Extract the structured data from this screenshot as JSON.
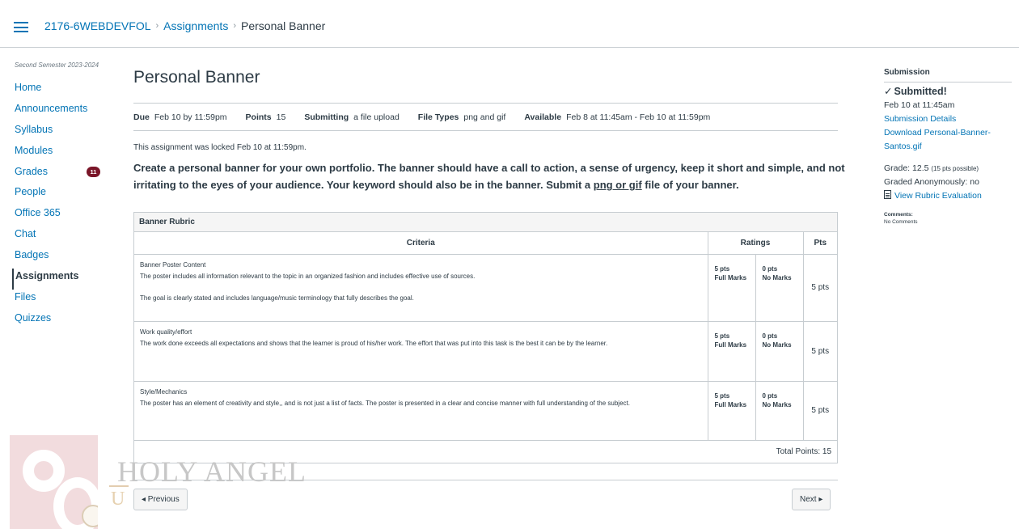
{
  "breadcrumb": {
    "course": "2176-6WEBDEVFOL",
    "section": "Assignments",
    "current": "Personal Banner"
  },
  "sidebar": {
    "term": "Second Semester 2023-2024",
    "items": [
      {
        "label": "Home"
      },
      {
        "label": "Announcements"
      },
      {
        "label": "Syllabus"
      },
      {
        "label": "Modules"
      },
      {
        "label": "Grades",
        "badge": "11"
      },
      {
        "label": "People"
      },
      {
        "label": "Office 365"
      },
      {
        "label": "Chat"
      },
      {
        "label": "Badges"
      },
      {
        "label": "Assignments",
        "active": true
      },
      {
        "label": "Files"
      },
      {
        "label": "Quizzes"
      }
    ]
  },
  "assignment": {
    "title": "Personal Banner",
    "due_label": "Due",
    "due": "Feb 10 by 11:59pm",
    "points_label": "Points",
    "points": "15",
    "submitting_label": "Submitting",
    "submitting": "a file upload",
    "filetypes_label": "File Types",
    "filetypes": "png and gif",
    "available_label": "Available",
    "available": "Feb 8 at 11:45am - Feb 10 at 11:59pm",
    "locked": "This assignment was locked Feb 10 at 11:59pm.",
    "description_pre": "Create a personal banner for your own portfolio. The banner should have a call to action, a sense of urgency, keep it short and simple, and not irritating to the eyes of your audience. Your keyword should also be in the banner. Submit a ",
    "description_link": "png or gif",
    "description_post": " file of your banner."
  },
  "rubric": {
    "title": "Banner Rubric",
    "headers": {
      "criteria": "Criteria",
      "ratings": "Ratings",
      "pts": "Pts"
    },
    "rows": [
      {
        "name": "Banner Poster Content",
        "desc": "The poster includes all information relevant to the topic in an organized fashion and includes effective use of sources.",
        "extra": "The goal is clearly stated and includes language/music terminology that fully describes the goal.",
        "r1_pts": "5 pts",
        "r1_label": "Full Marks",
        "r2_pts": "0 pts",
        "r2_label": "No Marks",
        "pts": "5 pts"
      },
      {
        "name": "Work quality/effort",
        "desc": "The work done exceeds all expectations and shows that the learner is proud of his/her work. The effort that was put into this task is the best it can be by the learner.",
        "extra": "",
        "r1_pts": "5 pts",
        "r1_label": "Full Marks",
        "r2_pts": "0 pts",
        "r2_label": "No Marks",
        "pts": "5 pts"
      },
      {
        "name": "Style/Mechanics",
        "desc": "The poster has an element of creativity and style,, and is not just a list of facts. The poster is presented in a clear and concise manner with full understanding of the subject.",
        "extra": "",
        "r1_pts": "5 pts",
        "r1_label": "Full Marks",
        "r2_pts": "0 pts",
        "r2_label": "No Marks",
        "pts": "5 pts"
      }
    ],
    "total": "Total Points: 15"
  },
  "footer_nav": {
    "previous": "◂ Previous",
    "next": "Next ▸"
  },
  "logo": {
    "line1": "HOLY ANGEL",
    "line2": "U"
  },
  "submission": {
    "heading": "Submission",
    "status": "Submitted!",
    "date": "Feb 10 at 11:45am",
    "details_link": "Submission Details",
    "download_link": "Download Personal-Banner-Santos.gif",
    "grade_prefix": "Grade: 12.5",
    "grade_possible": "(15 pts possible)",
    "anonymous": "Graded Anonymously: no",
    "rubric_link": "View Rubric Evaluation",
    "comments_label": "Comments:",
    "comments_value": "No Comments"
  },
  "colors": {
    "link": "#0374b5",
    "text": "#2d3b45",
    "badge": "#7a1528",
    "border": "#c7cdd1"
  }
}
